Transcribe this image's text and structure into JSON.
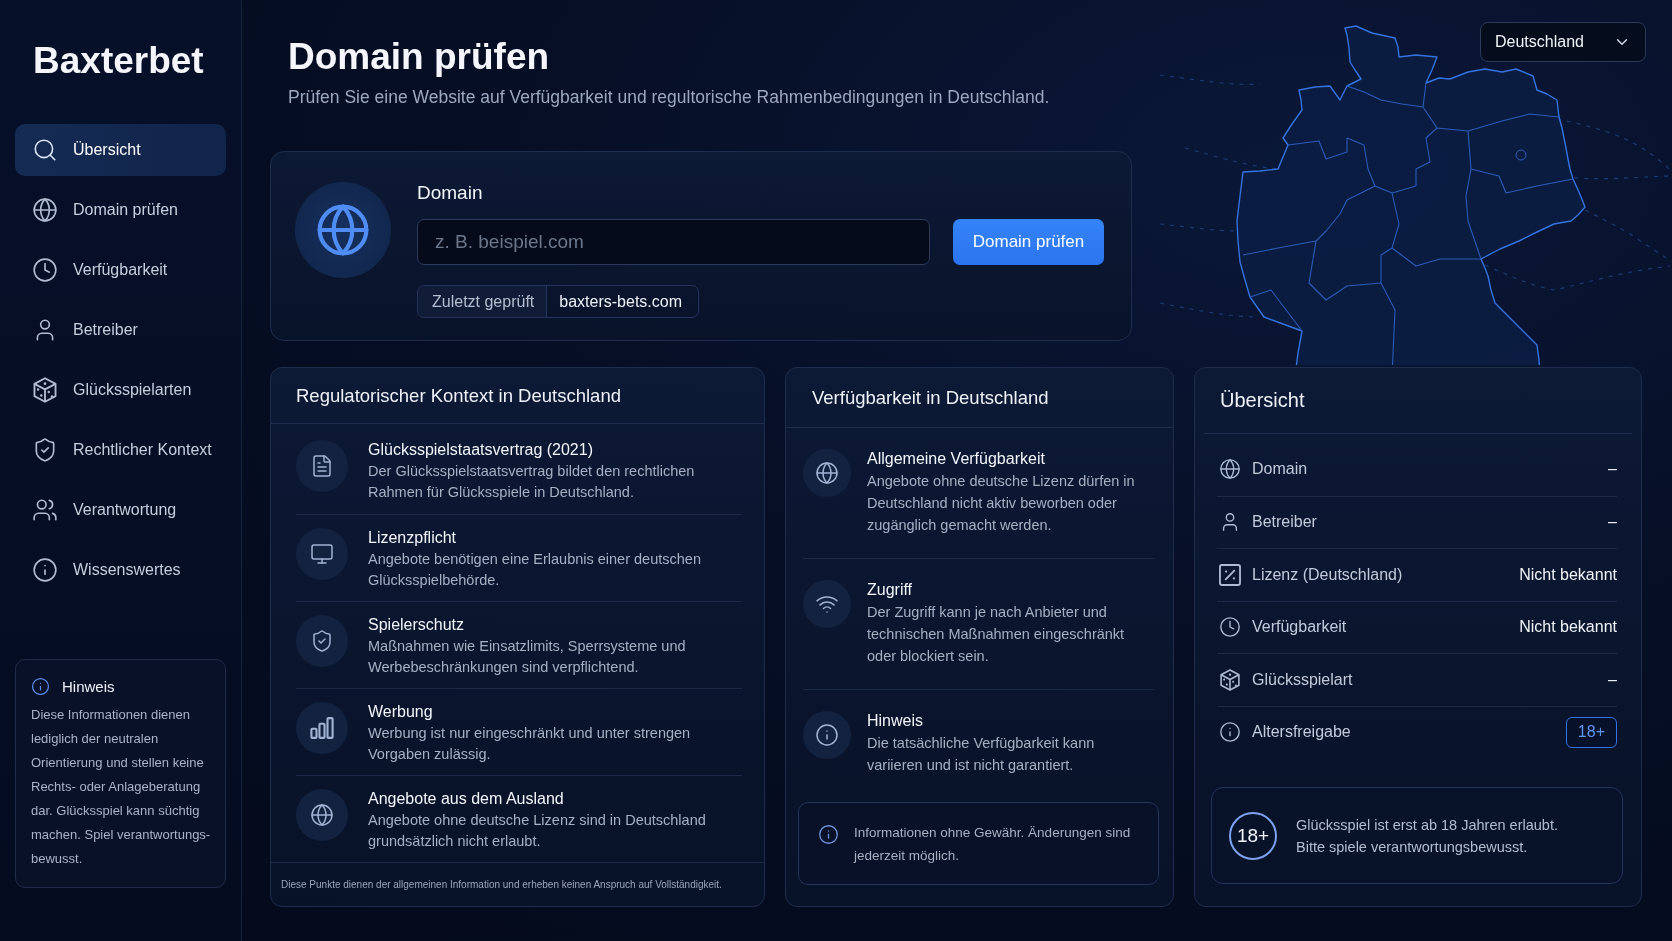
{
  "sidebar": {
    "brand": "Baxterbet",
    "items": [
      {
        "label": "Übersicht",
        "selected": true
      },
      {
        "label": "Domain prüfen",
        "selected": false
      },
      {
        "label": "Verfügbarkeit",
        "selected": false
      },
      {
        "label": "Betreiber",
        "selected": false
      },
      {
        "label": "Glücksspielarten",
        "selected": false
      },
      {
        "label": "Rechtlicher Kontext",
        "selected": false
      },
      {
        "label": "Verantwortung",
        "selected": false
      },
      {
        "label": "Wissenswertes",
        "selected": false
      }
    ],
    "notice": {
      "title": "Hinweis",
      "text": "Diese Informationen dienen lediglich der neutralen Orientierung und stellen keine Rechts- oder Anlageberatung dar. Glücksspiel kann süchtig machen. Spiel verantwortungs-bewusst."
    }
  },
  "header": {
    "title": "Domain prüfen",
    "subtitle": "Prüfen Sie eine Website auf Verfügbarkeit und regultorische Rahmenbedingungen in Deutschland."
  },
  "country_select": {
    "value": "Deutschland"
  },
  "domain_check": {
    "label": "Domain",
    "input": {
      "placeholder": "z. B. beispiel.com"
    },
    "button": "Domain prüfen",
    "last_checked": {
      "label": "Zuletzt geprüft",
      "value": "baxters-bets.com"
    }
  },
  "regulatory_context": {
    "title": "Regulatorischer Kontext in Deutschland",
    "items": [
      {
        "title": "Glücksspielstaatsvertrag (2021)",
        "text": "Der Glücksspielstaatsvertrag bildet den rechtlichen Rahmen für Glücksspiele in Deutschland."
      },
      {
        "title": "Lizenzpflicht",
        "text": "Angebote benötigen eine Erlaubnis einer deutschen Glücksspielbehörde."
      },
      {
        "title": "Spielerschutz",
        "text": "Maßnahmen wie Einsatzlimits, Sperrsysteme und Werbebeschränkungen sind verpflichtend."
      },
      {
        "title": "Werbung",
        "text": "Werbung ist nur eingeschränkt und unter strengen Vorgaben zulässig."
      },
      {
        "title": "Angebote aus dem Ausland",
        "text": "Angebote ohne deutsche Lizenz sind in Deutschland grundsätzlich nicht erlaubt."
      }
    ],
    "footer": "Diese Punkte dienen der allgemeinen Information und erheben keinen Anspruch auf Vollständigkeit."
  },
  "availability": {
    "title": "Verfügbarkeit in Deutschland",
    "items": [
      {
        "title": "Allgemeine Verfügbarkeit",
        "text": "Angebote ohne deutsche Lizenz dürfen in Deutschland nicht aktiv beworben oder zugänglich gemacht werden."
      },
      {
        "title": "Zugriff",
        "text": "Der Zugriff kann je nach Anbieter und technischen Maßnahmen eingeschränkt oder blockiert sein."
      },
      {
        "title": "Hinweis",
        "text": "Die tatsächliche Verfügbarkeit kann variieren und ist nicht garantiert."
      }
    ],
    "note": "Informationen ohne Gewähr. Änderungen sind jederzeit möglich."
  },
  "overview": {
    "title": "Übersicht",
    "rows": [
      {
        "label": "Domain",
        "value": "–",
        "kind": "text"
      },
      {
        "label": "Betreiber",
        "value": "–",
        "kind": "text"
      },
      {
        "label": "Lizenz (Deutschland)",
        "value": "Nicht bekannt",
        "kind": "text"
      },
      {
        "label": "Verfügbarkeit",
        "value": "Nicht bekannt",
        "kind": "text"
      },
      {
        "label": "Glücksspielart",
        "value": "–",
        "kind": "text"
      },
      {
        "label": "Altersfreigabe",
        "value": "18+",
        "kind": "badge"
      }
    ],
    "age_notice": {
      "badge": "18+",
      "text": "Glücksspiel ist erst ab 18 Jahren erlaubt. Bitte spiele verantwortungsbewusst."
    }
  }
}
